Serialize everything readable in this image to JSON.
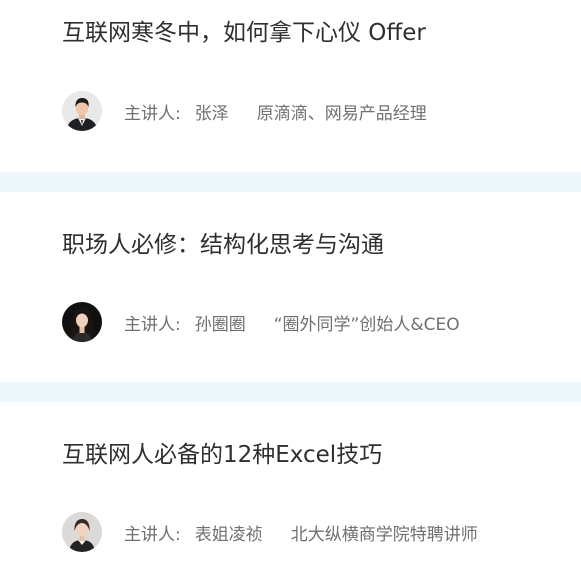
{
  "lectures": [
    {
      "title": "互联网寒冬中，如何拿下心仪 Offer",
      "speaker_label": "主讲人:",
      "speaker_name": "张泽",
      "speaker_title": "原滴滴、网易产品经理"
    },
    {
      "title": "职场人必修：结构化思考与沟通",
      "speaker_label": "主讲人:",
      "speaker_name": "孙圈圈",
      "speaker_title": "“圈外同学”创始人&CEO"
    },
    {
      "title": "互联网人必备的12种Excel技巧",
      "speaker_label": "主讲人:",
      "speaker_name": "表姐凌祯",
      "speaker_title": "北大纵横商学院特聘讲师"
    }
  ],
  "colors": {
    "divider": "#eef7fb",
    "title": "#2f2f2f",
    "meta": "#707070"
  }
}
